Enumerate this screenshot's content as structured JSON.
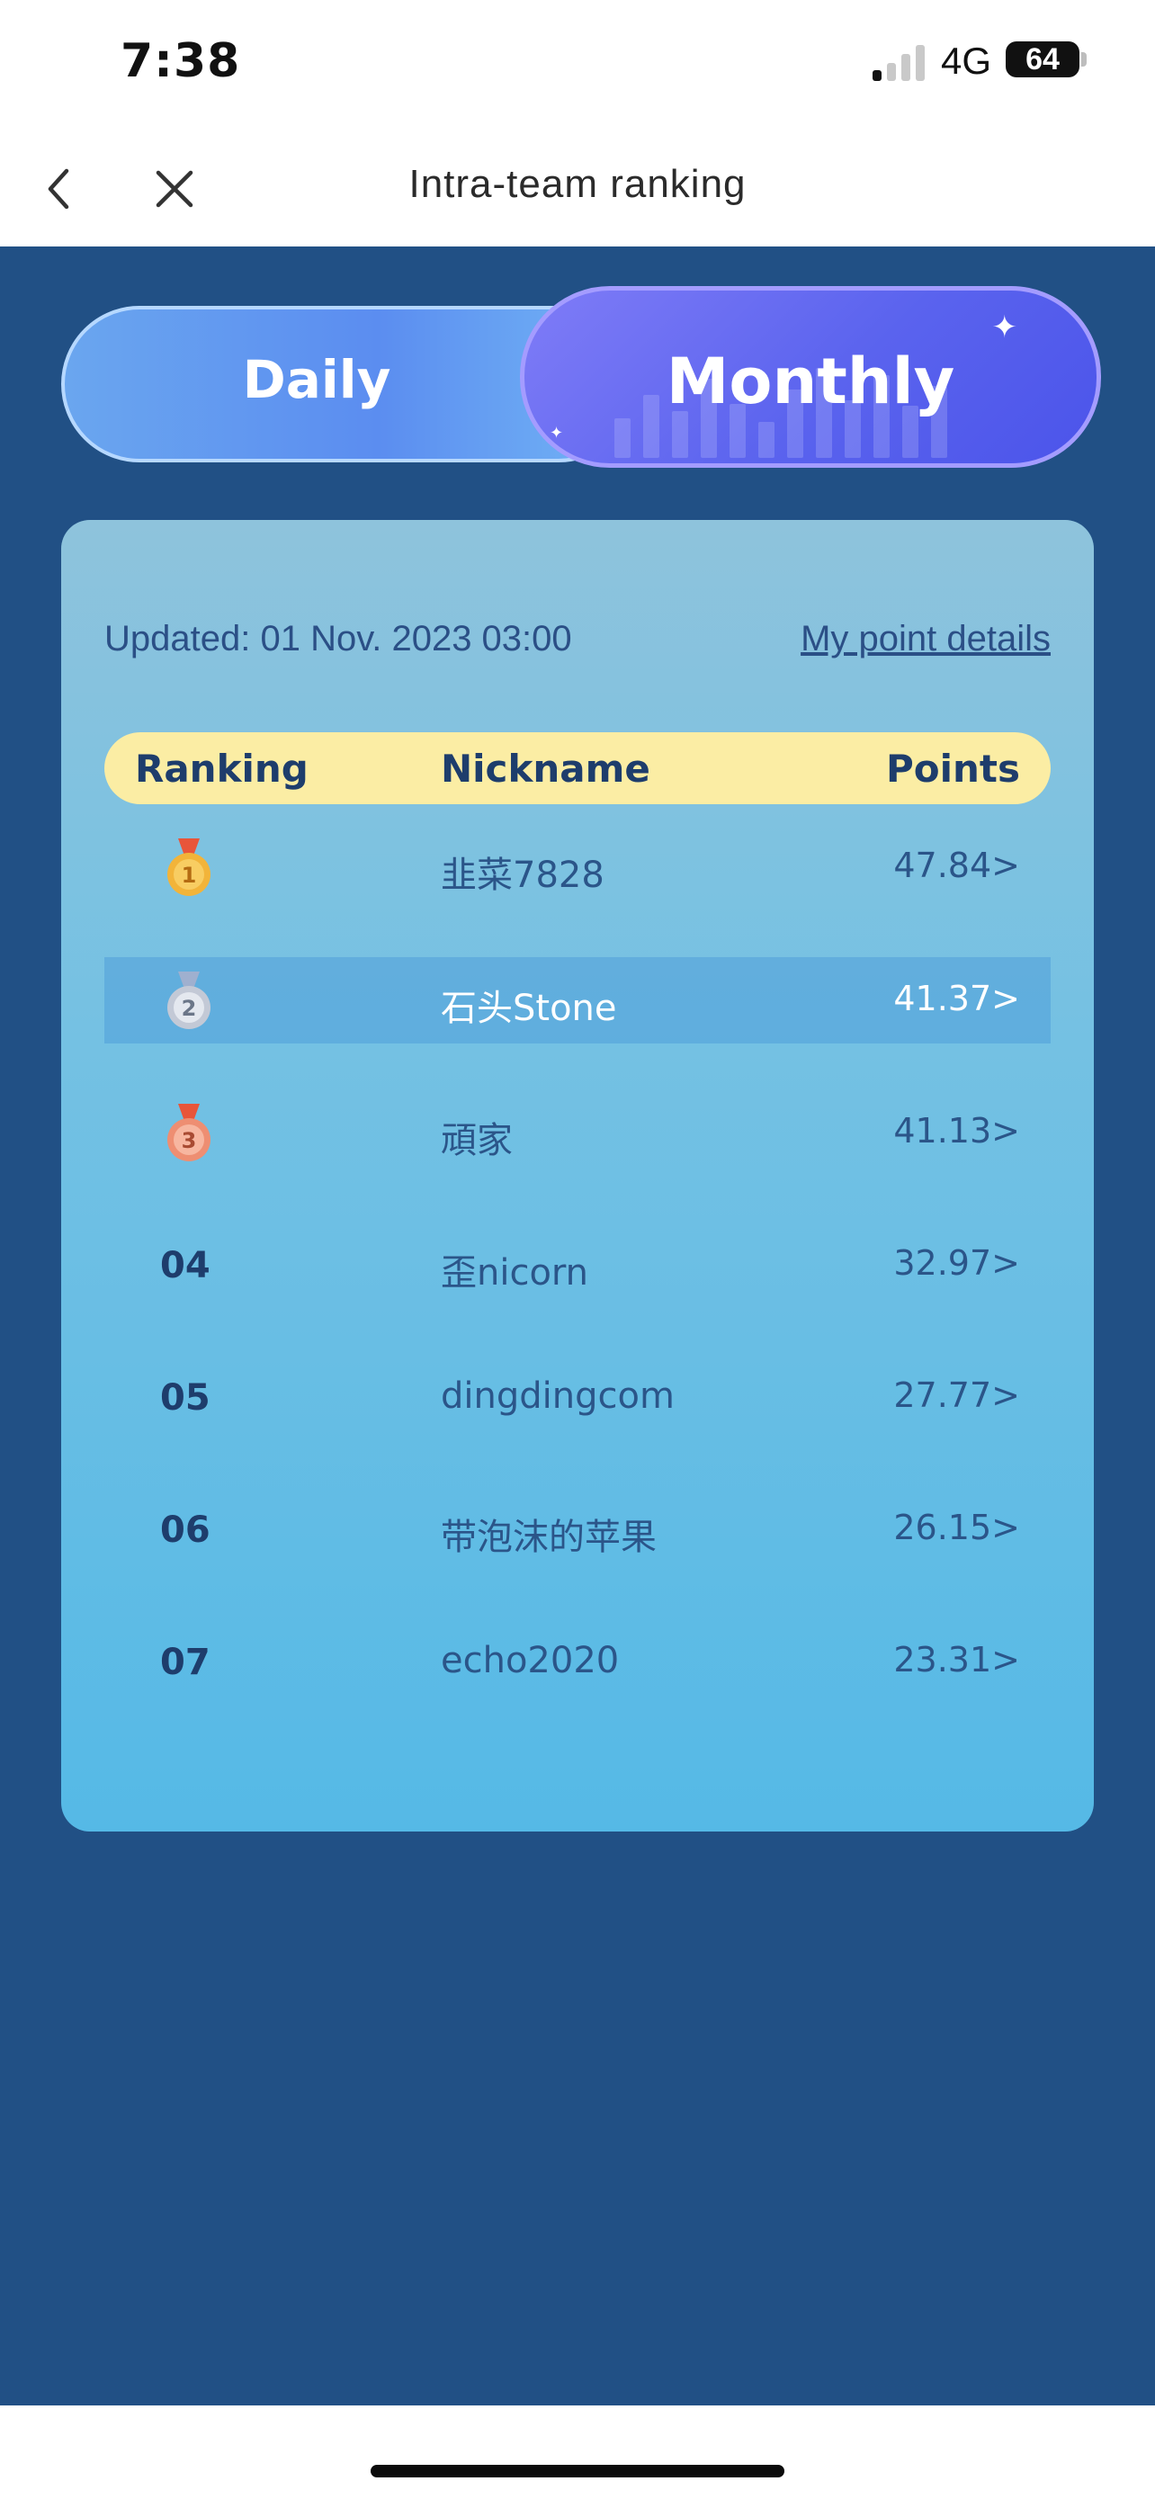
{
  "status_bar": {
    "time": "7:38",
    "network": "4G",
    "battery": "64"
  },
  "nav": {
    "title": "Intra-team ranking",
    "back_icon": "chevron-left-icon",
    "close_icon": "close-icon"
  },
  "tabs": {
    "daily": "Daily",
    "monthly": "Monthly",
    "active": "Monthly"
  },
  "card": {
    "updated": "Updated: 01 Nov. 2023 03:00",
    "details_link": "My point details"
  },
  "table": {
    "headers": {
      "ranking": "Ranking",
      "nickname": "Nickname",
      "points": "Points"
    },
    "rows": [
      {
        "rank": "1",
        "medal": "gold-medal-icon",
        "nickname": "韭菜7828",
        "points": "47.84>"
      },
      {
        "rank": "2",
        "medal": "silver-medal-icon",
        "nickname": "石头Stone",
        "points": "41.37>"
      },
      {
        "rank": "3",
        "medal": "bronze-medal-icon",
        "nickname": "頑家",
        "points": "41.13>"
      },
      {
        "rank": "04",
        "nickname": "歪nicorn",
        "points": "32.97>"
      },
      {
        "rank": "05",
        "nickname": "dingdingcom",
        "points": "27.77>"
      },
      {
        "rank": "06",
        "nickname": "带泡沫的苹果",
        "points": "26.15>"
      },
      {
        "rank": "07",
        "nickname": "echo2020",
        "points": "23.31>"
      }
    ]
  },
  "colors": {
    "background": "#215085",
    "header_pill": "#fbeda4",
    "text_dark": "#1e3d6c",
    "tab_active": "#5a63ee",
    "tab_inactive": "#6aa6ef",
    "gold": "#f2b43a",
    "silver": "#c3c9d6",
    "bronze": "#ee8e72"
  }
}
